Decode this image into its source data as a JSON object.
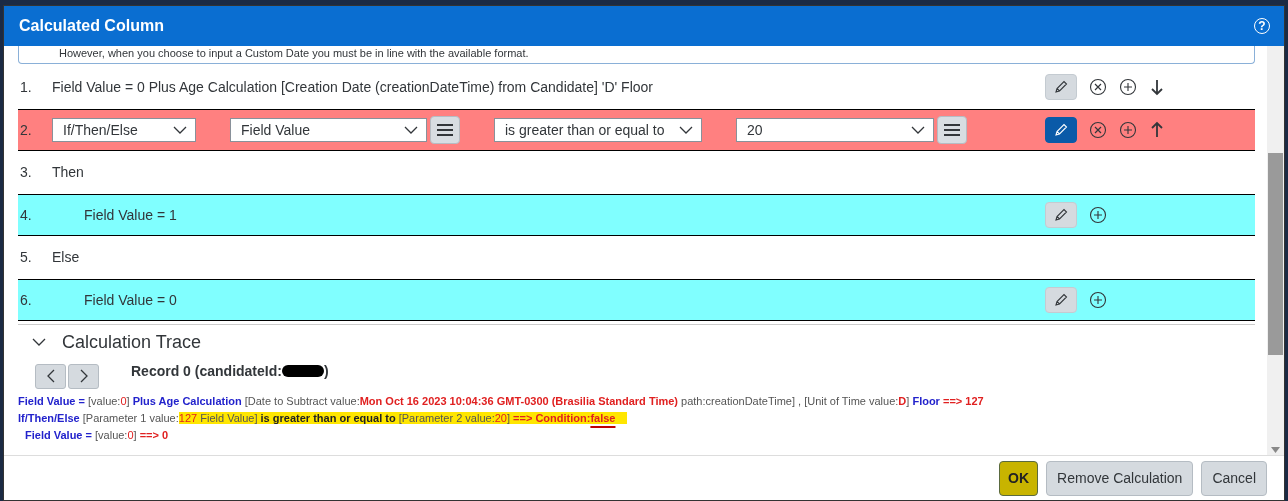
{
  "dialog": {
    "title": "Calculated Column",
    "help": "?"
  },
  "note": "However, when you choose to input a Custom Date you must be in line with the available format.",
  "rules": [
    {
      "number": "1.",
      "kind": "text",
      "text": "Field Value = 0 Plus Age Calculation [Creation Date (creationDateTime) from Candidate] 'D' Floor",
      "indented": false,
      "actions": [
        {
          "kind": "edit",
          "active": false
        },
        {
          "kind": "remove"
        },
        {
          "kind": "add"
        },
        {
          "kind": "move_down"
        }
      ]
    },
    {
      "number": "2.",
      "kind": "condition",
      "color": "#ff8080",
      "fields": [
        {
          "value": "If/Then/Else",
          "menu": false
        },
        {
          "value": "Field Value",
          "menu": true
        },
        {
          "value": "is greater than or equal to",
          "menu": false
        },
        {
          "value": "20",
          "menu": true
        }
      ],
      "actions": [
        {
          "kind": "edit",
          "active": true
        },
        {
          "kind": "remove"
        },
        {
          "kind": "add"
        },
        {
          "kind": "move_up"
        }
      ]
    },
    {
      "number": "3.",
      "kind": "text",
      "text": "Then",
      "indented": false
    },
    {
      "number": "4.",
      "kind": "text",
      "color": "#80ffff",
      "text": "Field Value = 1",
      "indented": true,
      "actions": [
        {
          "kind": "edit",
          "active": false
        },
        {
          "kind": "add"
        }
      ]
    },
    {
      "number": "5.",
      "kind": "text",
      "text": "Else",
      "indented": false
    },
    {
      "number": "6.",
      "kind": "text",
      "color": "#80ffff",
      "text": "Field Value = 0",
      "indented": true,
      "actions": [
        {
          "kind": "edit",
          "active": false
        },
        {
          "kind": "add"
        }
      ]
    }
  ],
  "trace": {
    "title": "Calculation Trace",
    "expanded": true,
    "record_label": "Record 0 (candidateId:",
    "record_end": ")",
    "redacted": true,
    "lines": [
      {
        "indented": false,
        "segments": [
          {
            "kind": "keyword",
            "text": "Field Value =",
            "highlighted": false,
            "underlined": false
          },
          {
            "kind": "plain",
            "text": " [value:",
            "highlighted": false,
            "underlined": false
          },
          {
            "kind": "value",
            "text": "0",
            "highlighted": false,
            "underlined": false
          },
          {
            "kind": "plain",
            "text": "] ",
            "highlighted": false,
            "underlined": false
          },
          {
            "kind": "keyword",
            "text": "Plus Age Calculation",
            "highlighted": false,
            "underlined": false
          },
          {
            "kind": "plain",
            "text": " [Date to Subtract value:",
            "highlighted": false,
            "underlined": false
          },
          {
            "kind": "strong_value",
            "text": "Mon Oct 16 2023 10:04:36 GMT-0300 (Brasilia Standard Time)",
            "highlighted": false,
            "underlined": false
          },
          {
            "kind": "plain",
            "text": " path:creationDateTime] , [Unit of Time value:",
            "highlighted": false,
            "underlined": false
          },
          {
            "kind": "strong_value",
            "text": "D",
            "highlighted": false,
            "underlined": false
          },
          {
            "kind": "plain",
            "text": "] ",
            "highlighted": false,
            "underlined": false
          },
          {
            "kind": "keyword",
            "text": "Floor",
            "highlighted": false,
            "underlined": false
          },
          {
            "kind": "strong_value",
            "text": " ==> 127",
            "highlighted": false,
            "underlined": false
          }
        ]
      },
      {
        "indented": false,
        "segments": [
          {
            "kind": "keyword",
            "text": "If/Then/Else",
            "highlighted": false,
            "underlined": false
          },
          {
            "kind": "plain",
            "text": " [Parameter 1 value:",
            "highlighted": false,
            "underlined": false
          },
          {
            "kind": "value",
            "text": "127",
            "highlighted": true,
            "underlined": false
          },
          {
            "kind": "plain",
            "text": " Field Value]",
            "highlighted": true,
            "underlined": false
          },
          {
            "kind": "operator",
            "text": " is greater than or equal to ",
            "highlighted": true,
            "underlined": false
          },
          {
            "kind": "plain",
            "text": "[Parameter 2 value:",
            "highlighted": true,
            "underlined": false
          },
          {
            "kind": "value",
            "text": "20",
            "highlighted": true,
            "underlined": false
          },
          {
            "kind": "plain",
            "text": "] ",
            "highlighted": true,
            "underlined": false
          },
          {
            "kind": "strong_value",
            "text": "==> Condition:",
            "highlighted": true,
            "underlined": false
          },
          {
            "kind": "strong_value",
            "text": "false",
            "highlighted": true,
            "underlined": true
          }
        ]
      },
      {
        "indented": true,
        "segments": [
          {
            "kind": "keyword",
            "text": "Field Value =",
            "highlighted": false,
            "underlined": false
          },
          {
            "kind": "plain",
            "text": " [value:",
            "highlighted": false,
            "underlined": false
          },
          {
            "kind": "value",
            "text": "0",
            "highlighted": false,
            "underlined": false
          },
          {
            "kind": "plain",
            "text": "] ",
            "highlighted": false,
            "underlined": false
          },
          {
            "kind": "strong_value",
            "text": "==> 0",
            "highlighted": false,
            "underlined": false
          }
        ]
      }
    ]
  },
  "buttons": [
    {
      "label": "OK",
      "kind": "emphasized"
    },
    {
      "label": "Remove Calculation",
      "kind": "default"
    },
    {
      "label": "Cancel",
      "kind": "default"
    }
  ]
}
